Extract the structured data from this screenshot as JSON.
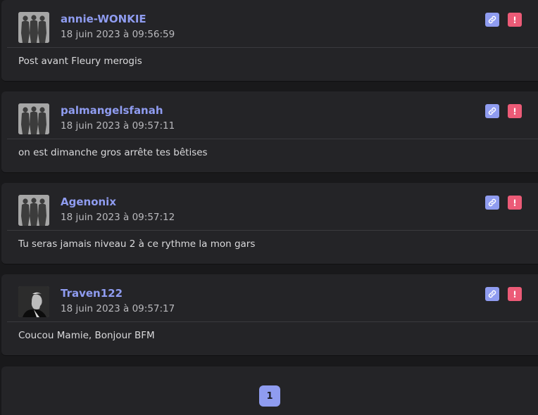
{
  "posts": [
    {
      "author": "annie-WONKIE",
      "date": "18 juin 2023 à 09:56:59",
      "text": "Post avant Fleury merogis",
      "avatar_icon": "group-silhouette-avatar"
    },
    {
      "author": "palmangelsfanah",
      "date": "18 juin 2023 à 09:57:11",
      "text": "on est dimanche gros arrête tes bêtises",
      "avatar_icon": "group-silhouette-avatar"
    },
    {
      "author": "Agenonix",
      "date": "18 juin 2023 à 09:57:12",
      "text": "Tu seras jamais niveau 2 à ce rythme la mon gars",
      "avatar_icon": "group-silhouette-avatar"
    },
    {
      "author": "Traven122",
      "date": "18 juin 2023 à 09:57:17",
      "text": "Coucou Mamie, Bonjour BFM",
      "avatar_icon": "portrait-avatar"
    }
  ],
  "actions": {
    "link_icon": "link-icon",
    "report_icon": "exclamation-icon"
  },
  "pagination": {
    "current_page": "1"
  },
  "colors": {
    "accent": "#8f9cf0",
    "report": "#ec5b77",
    "card": "#242427",
    "background": "#19191b"
  }
}
